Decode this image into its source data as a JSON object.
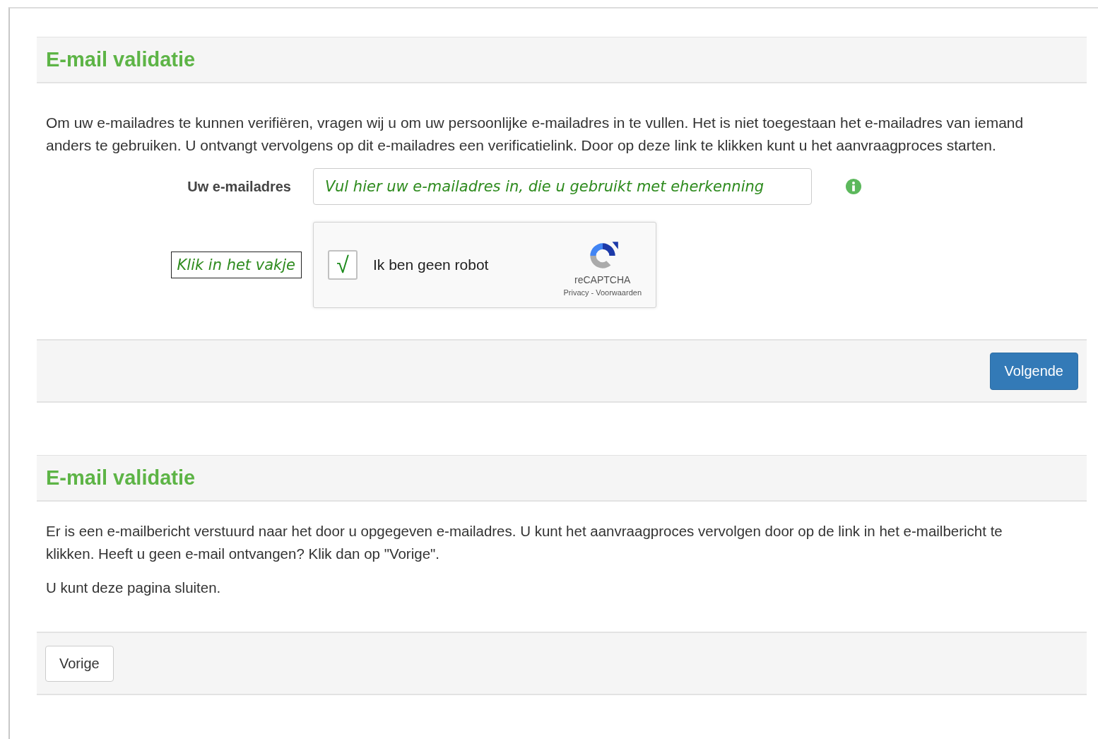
{
  "panels": [
    {
      "kind": "form",
      "title": "E-mail validatie",
      "paragraphs": [
        "Om uw e-mailadres te kunnen verifiëren, vragen wij u om uw persoonlijke e-mailadres in te vullen. Het is niet toegestaan het e-mailadres van iemand anders te gebruiken. U ontvangt vervolgens op dit e-mailadres een verificatielink. Door op deze link te klikken kunt u het aanvraagproces starten."
      ],
      "email": {
        "label": "Uw e-mailadres",
        "value": "Vul hier uw e-mailadres in, die u gebruikt met eherkenning"
      },
      "captcha": {
        "annotation": "Klik in het vakje",
        "checked": true,
        "check_mark": "√",
        "label": "Ik ben geen robot",
        "brand": "reCAPTCHA",
        "links": [
          "Privacy",
          "Voorwaarden"
        ],
        "link_separator": "-"
      },
      "footer_button": {
        "label": "Volgende",
        "kind": "primary"
      }
    },
    {
      "kind": "message",
      "title": "E-mail validatie",
      "paragraphs": [
        "Er is een e-mailbericht verstuurd naar het door u opgegeven e-mailadres. U kunt het aanvraagproces vervolgen door op de link in het e-mailbericht te klikken. Heeft u geen e-mail ontvangen? Klik dan op \"Vorige\".",
        "U kunt deze pagina sluiten."
      ],
      "footer_button": {
        "label": "Vorige",
        "kind": "default"
      }
    }
  ]
}
